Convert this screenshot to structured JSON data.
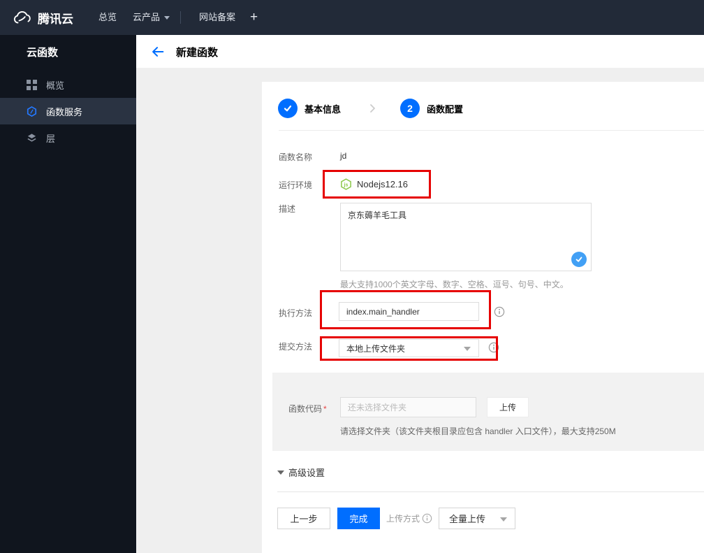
{
  "colors": {
    "accent_blue": "#006eff",
    "annotation_red": "#e60000",
    "node_green": "#8cc84b",
    "check_blue": "#42a0f5",
    "topbar_bg": "#222a38",
    "sidebar_bg": "#10151e"
  },
  "topbar": {
    "brand": "腾讯云",
    "nav_overview": "总览",
    "nav_products": "云产品",
    "nav_icp": "网站备案",
    "nav_add": "+"
  },
  "sidebar": {
    "title": "云函数",
    "items": [
      {
        "label": "概览",
        "icon": "grid-icon",
        "active": false
      },
      {
        "label": "函数服务",
        "icon": "function-hexagon-icon",
        "active": true
      },
      {
        "label": "层",
        "icon": "layers-icon",
        "active": false
      }
    ]
  },
  "header": {
    "title": "新建函数",
    "back_icon": "arrow-left-icon"
  },
  "stepper": {
    "steps": [
      {
        "label": "基本信息",
        "state": "done",
        "icon": "check-icon"
      },
      {
        "label": "函数配置",
        "number": "2",
        "state": "current"
      }
    ]
  },
  "form": {
    "name": {
      "label": "函数名称",
      "value": "jd"
    },
    "runtime": {
      "label": "运行环境",
      "value": "Nodejs12.16",
      "icon": "nodejs-icon"
    },
    "description": {
      "label": "描述",
      "value": "京东薅羊毛工具",
      "hint": "最大支持1000个英文字母、数字、空格、逗号、句号、中文。"
    },
    "handler": {
      "label": "执行方法",
      "value": "index.main_handler"
    },
    "submit_method": {
      "label": "提交方法",
      "value": "本地上传文件夹"
    },
    "code": {
      "label": "函数代码",
      "required_mark": "*",
      "placeholder": "还未选择文件夹",
      "upload_button": "上传",
      "hint": "请选择文件夹（该文件夹根目录应包含 handler 入口文件），最大支持250M"
    },
    "advanced_label": "高级设置"
  },
  "footer": {
    "prev_button": "上一步",
    "finish_button": "完成",
    "upload_mode_label": "上传方式",
    "upload_mode_value": "全量上传"
  }
}
